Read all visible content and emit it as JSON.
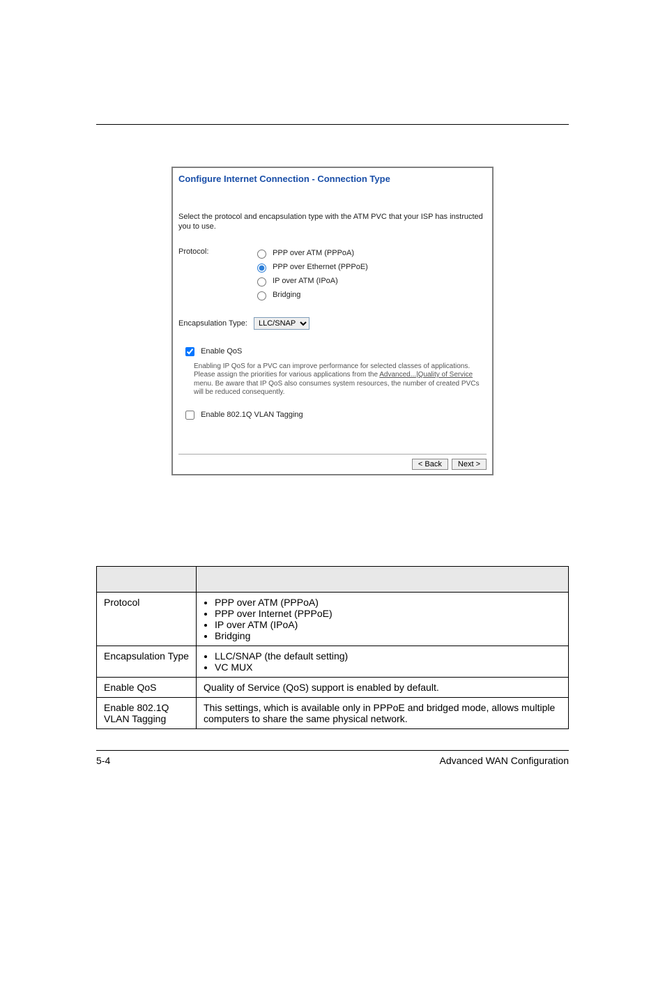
{
  "shot": {
    "title": "Configure Internet Connection - Connection Type",
    "intro": "Select the protocol and encapsulation type with the ATM PVC that your ISP has instructed you to use.",
    "protocol_label": "Protocol:",
    "protocols": {
      "pppoa": "PPP over ATM (PPPoA)",
      "pppoe": "PPP over Ethernet (PPPoE)",
      "ipoa": "IP over ATM (IPoA)",
      "bridge": "Bridging"
    },
    "enc_label": "Encapsulation Type:",
    "enc_value": "LLC/SNAP",
    "qos_label": "Enable QoS",
    "qos_desc_pre": "Enabling IP QoS for a PVC can improve performance for selected classes of applications. Please assign the priorities for various applications from the ",
    "qos_desc_link": "Advanced...|Quality of Service",
    "qos_desc_post": " menu. Be aware that IP QoS also consumes system resources, the number of created PVCs will be reduced consequently.",
    "vlan_label": "Enable 802.1Q VLAN Tagging",
    "back": "< Back",
    "next": "Next >"
  },
  "table": {
    "rows": {
      "protocol": {
        "k": "Protocol",
        "items": [
          "PPP over ATM (PPPoA)",
          "PPP over Internet (PPPoE)",
          "IP over ATM (IPoA)",
          "Bridging"
        ]
      },
      "enc": {
        "k": "Encapsulation Type",
        "items": [
          "LLC/SNAP (the default setting)",
          "VC MUX"
        ]
      },
      "qos": {
        "k": "Enable QoS",
        "v": "Quality of Service (QoS) support is enabled by default."
      },
      "vlan": {
        "k": "Enable 802.1Q VLAN Tagging",
        "v": "This settings, which is available only in PPPoE and bridged mode, allows multiple computers to share the same physical network."
      }
    }
  },
  "footer": {
    "page": "5-4",
    "section": "Advanced WAN Configuration"
  }
}
